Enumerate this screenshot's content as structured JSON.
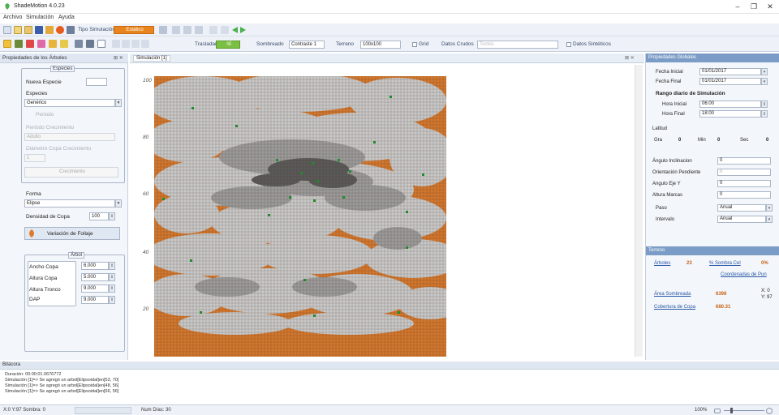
{
  "window": {
    "title": "ShadeMotion 4.0.23",
    "min_glyph": "–",
    "max_glyph": "❐",
    "close_glyph": "✕"
  },
  "menu": {
    "items": [
      "Archivo",
      "Simulación",
      "Ayuda"
    ]
  },
  "toolbar": {
    "tipo_simulacion_label": "Tipo Simulación",
    "tipo_simulacion_value": "Estático",
    "trasladar_label": "Trasladar",
    "trasladar_value": "SÍ",
    "sombreado_label": "Sombreado",
    "contraste_value": "Contraste 1",
    "terreno_label": "Terreno",
    "terreno_value": "100x100",
    "grid_label": "Grid",
    "datos_crudos_label": "Datos Crudos",
    "datos_crudos_placeholder": "Tontos",
    "datos_sinteticos_label": "Datos Sintéticos"
  },
  "left_panel": {
    "header": "Propiedades de los Árboles",
    "pin_glyph": "⊞ ✕",
    "especies_title": "Especies",
    "nueva_especie_label": "Nueva Especie",
    "especies_label": "Especies",
    "especies_value": "Genérico",
    "periodo_label": "Periodo",
    "periodo_crecimiento_label": "Período Crecimiento",
    "adulto_value": "Adulto",
    "diametro_label": "Diámetro Copa Crecimiento",
    "diametro_value": "1",
    "crecimiento_btn": "Crecimiento",
    "forma_label": "Forma",
    "forma_value": "Elipse",
    "densidad_label": "Densidad de Copa",
    "densidad_value": "100",
    "variacion_btn": "Variación de Follaje",
    "arbol_title": "Árbol",
    "ancho_label": "Ancho Copa",
    "ancho_value": "6.000",
    "altura_copa_label": "Altura Copa",
    "altura_copa_value": "5.000",
    "altura_tronco_label": "Altura Tronco",
    "altura_tronco_value": "9.000",
    "dap_label": "DAP",
    "dap_value": "9.000"
  },
  "simulation": {
    "tab_label": "Simulación [1]",
    "close_glyphs": "⊠ ✕",
    "y_ticks": [
      "100",
      "80",
      "60",
      "40",
      "20"
    ],
    "colors": {
      "ground": "#d2772e",
      "grid": "#4a3520",
      "shade_light": "#c9c9c9",
      "shade_mid": "#9b9b9b",
      "shade_dark": "#5a5a5a",
      "tree": "#1f8a2e"
    }
  },
  "right_panel": {
    "header": "Propiedades Globales",
    "fecha_inicial_label": "Fecha Inicial",
    "fecha_inicial_value": "01/01/2017",
    "fecha_final_label": "Fecha Final",
    "fecha_final_value": "01/01/2017",
    "rango_title": "Rango diario de Simulación",
    "hora_inicial_label": "Hora Inicial",
    "hora_inicial_value": "06:00",
    "hora_final_label": "Hora Final",
    "hora_final_value": "18:00",
    "latitud_label": "Latitud",
    "gra_label": "Gra",
    "gra_value": "0",
    "min_label": "Min",
    "min_value": "0",
    "sec_label": "Sec",
    "sec_value": "0",
    "angulo_inclinacion_label": "Ángulo Inclinacion",
    "angulo_inclinacion_value": "0",
    "orientacion_label": "Orientación Pendiente",
    "orientacion_value": "0",
    "angulo_eje_label": "Angulo Eje Y",
    "angulo_eje_value": "0",
    "altura_marcas_label": "Altura Marcas",
    "altura_marcas_value": "0",
    "paso_label": "Paso",
    "paso_value": "Anual",
    "intervalo_label": "Intervalo",
    "intervalo_value": "Anual",
    "terreno_header": "Terreno",
    "arboles_label": "Árboles",
    "arboles_value": "23",
    "sombra_cel_label": "% Sombra Cel",
    "sombra_cel_value": "0%",
    "coordenadas_label": "Coordenadas de Pun",
    "area_sombreada_label": "Área Sombreada",
    "area_sombreada_value": "6398",
    "cobertura_label": "Cobertura de Copa",
    "cobertura_value": "680.31",
    "x_coord": "X: 0",
    "y_coord": "Y: 97"
  },
  "bitacora": {
    "header": "Bitácora",
    "lines": [
      "Duración: 00:00:01.0676772",
      "Simulación [1]=> Se agregó un arbol[Elipsoidal]en[53, 70]",
      "Simulación [1]=> Se agregó un arbol[Elipsoidal]en[48, 56]",
      "Simulación [1]=> Se agregó un arbol[Elipsoidal]en[66, 56]"
    ]
  },
  "status": {
    "coords": "X:0  Y:97  Sombra: 0",
    "num_dias": "Num Días: 30",
    "zoom": "100%"
  }
}
